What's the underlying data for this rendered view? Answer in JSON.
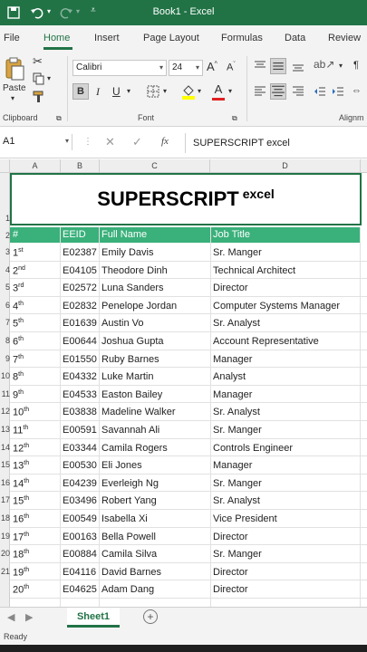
{
  "app": {
    "title": "Book1 - Excel",
    "accent": "#217346",
    "header_fill": "#3ab07b"
  },
  "tabs": [
    "File",
    "Home",
    "Insert",
    "Page Layout",
    "Formulas",
    "Data",
    "Review"
  ],
  "ribbon": {
    "paste_label": "Paste",
    "clipboard_label": "Clipboard",
    "font_label": "Font",
    "alignment_label": "Alignm",
    "font_name": "Calibri",
    "font_size": "24",
    "bold": "B",
    "italic": "I",
    "underline": "U",
    "grow": "A",
    "shrink": "A",
    "font_color_letter": "A"
  },
  "formula_bar": {
    "name_box": "A1",
    "fx": "fx",
    "content": "SUPERSCRIPT excel"
  },
  "columns": [
    "A",
    "B",
    "C",
    "D"
  ],
  "sheet": {
    "title_main": "SUPERSCRIPT",
    "title_sup": "excel",
    "headers": [
      "#",
      "EEID",
      "Full Name",
      "Job Title"
    ],
    "row_numbers": [
      "1",
      "2",
      "3",
      "4",
      "5",
      "6",
      "7",
      "8",
      "9",
      "10",
      "11",
      "12",
      "13",
      "14",
      "15",
      "16",
      "17",
      "18",
      "19",
      "20",
      "21"
    ],
    "rows": [
      {
        "n": "1",
        "sup": "st",
        "id": "E02387",
        "name": "Emily Davis",
        "title": "Sr. Manger"
      },
      {
        "n": "2",
        "sup": "nd",
        "id": "E04105",
        "name": "Theodore Dinh",
        "title": "Technical Architect"
      },
      {
        "n": "3",
        "sup": "rd",
        "id": "E02572",
        "name": "Luna Sanders",
        "title": "Director"
      },
      {
        "n": "4",
        "sup": "th",
        "id": "E02832",
        "name": "Penelope Jordan",
        "title": "Computer Systems Manager"
      },
      {
        "n": "5",
        "sup": "th",
        "id": "E01639",
        "name": "Austin Vo",
        "title": "Sr. Analyst"
      },
      {
        "n": "6",
        "sup": "th",
        "id": "E00644",
        "name": "Joshua Gupta",
        "title": "Account Representative"
      },
      {
        "n": "7",
        "sup": "th",
        "id": "E01550",
        "name": "Ruby Barnes",
        "title": "Manager"
      },
      {
        "n": "8",
        "sup": "th",
        "id": "E04332",
        "name": "Luke Martin",
        "title": "Analyst"
      },
      {
        "n": "9",
        "sup": "th",
        "id": "E04533",
        "name": "Easton Bailey",
        "title": "Manager"
      },
      {
        "n": "10",
        "sup": "th",
        "id": "E03838",
        "name": "Madeline Walker",
        "title": "Sr. Analyst"
      },
      {
        "n": "11",
        "sup": "th",
        "id": "E00591",
        "name": "Savannah Ali",
        "title": "Sr. Manger"
      },
      {
        "n": "12",
        "sup": "th",
        "id": "E03344",
        "name": "Camila Rogers",
        "title": "Controls Engineer"
      },
      {
        "n": "13",
        "sup": "th",
        "id": "E00530",
        "name": "Eli Jones",
        "title": "Manager"
      },
      {
        "n": "14",
        "sup": "th",
        "id": "E04239",
        "name": "Everleigh Ng",
        "title": "Sr. Manger"
      },
      {
        "n": "15",
        "sup": "th",
        "id": "E03496",
        "name": "Robert Yang",
        "title": "Sr. Analyst"
      },
      {
        "n": "16",
        "sup": "th",
        "id": "E00549",
        "name": "Isabella Xi",
        "title": "Vice President"
      },
      {
        "n": "17",
        "sup": "th",
        "id": "E00163",
        "name": "Bella Powell",
        "title": "Director"
      },
      {
        "n": "18",
        "sup": "th",
        "id": "E00884",
        "name": "Camila Silva",
        "title": "Sr. Manger"
      },
      {
        "n": "19",
        "sup": "th",
        "id": "E04116",
        "name": "David Barnes",
        "title": "Director"
      },
      {
        "n": "20",
        "sup": "th",
        "id": "E04625",
        "name": "Adam Dang",
        "title": "Director"
      }
    ]
  },
  "sheet_tab": "Sheet1",
  "status": "Ready"
}
